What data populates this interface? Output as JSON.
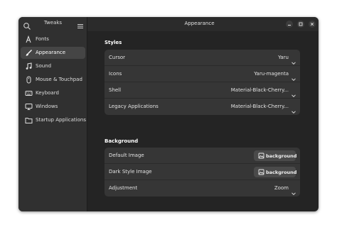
{
  "sidebar": {
    "title": "Tweaks",
    "items": [
      {
        "label": "Fonts",
        "icon": "font-icon",
        "active": false
      },
      {
        "label": "Appearance",
        "icon": "brush-icon",
        "active": true
      },
      {
        "label": "Sound",
        "icon": "music-note-icon",
        "active": false
      },
      {
        "label": "Mouse & Touchpad",
        "icon": "mouse-icon",
        "active": false
      },
      {
        "label": "Keyboard",
        "icon": "keyboard-icon",
        "active": false
      },
      {
        "label": "Windows",
        "icon": "monitor-icon",
        "active": false
      },
      {
        "label": "Startup Applications",
        "icon": "folder-icon",
        "active": false
      }
    ]
  },
  "header": {
    "title": "Appearance"
  },
  "styles": {
    "heading": "Styles",
    "rows": [
      {
        "label": "Cursor",
        "value": "Yaru"
      },
      {
        "label": "Icons",
        "value": "Yaru-magenta"
      },
      {
        "label": "Shell",
        "value": "Material-Black-Cherry..."
      },
      {
        "label": "Legacy Applications",
        "value": "Material-Black-Cherry..."
      }
    ]
  },
  "background": {
    "heading": "Background",
    "default_image": {
      "label": "Default Image",
      "button": "background"
    },
    "dark_style_image": {
      "label": "Dark Style Image",
      "button": "background"
    },
    "adjustment": {
      "label": "Adjustment",
      "value": "Zoom"
    }
  },
  "colors": {
    "window_bg": "#242424",
    "sidebar_bg": "#303030",
    "row_bg": "#363636",
    "active_item_bg": "#454545"
  }
}
